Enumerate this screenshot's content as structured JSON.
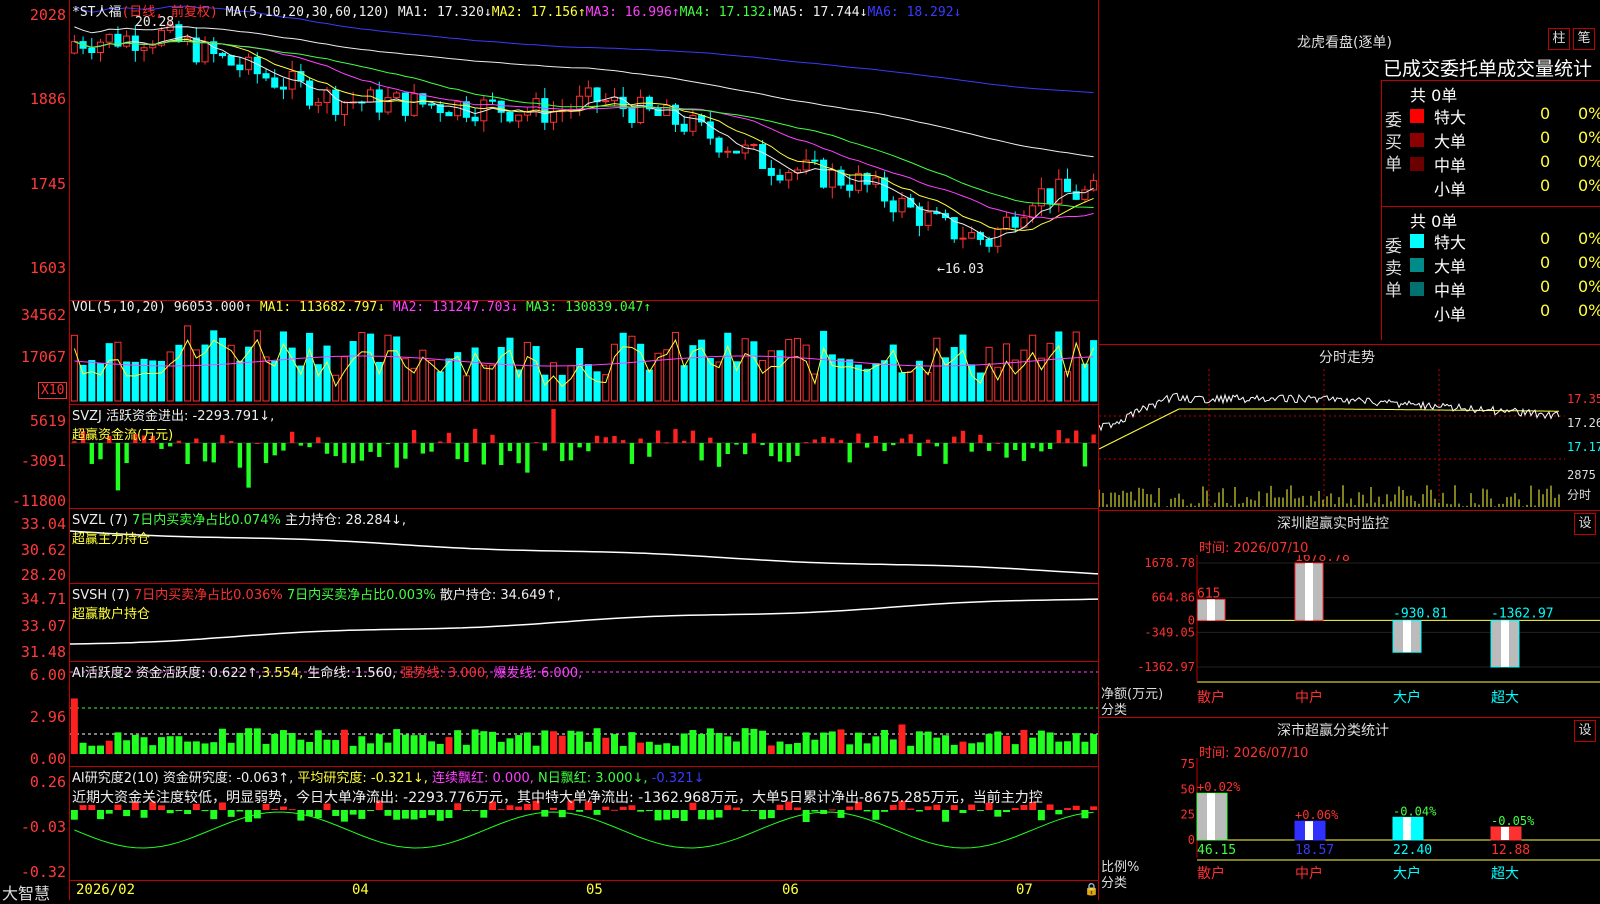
{
  "main_chart": {
    "stock_name": "*ST人福",
    "period_label": "(日线, 前复权)",
    "ma_header": "MA(5,10,20,30,60,120)",
    "ma": [
      {
        "label": "MA1: 17.320↓",
        "color": "#eeeeee"
      },
      {
        "label": "MA2: 17.156↑",
        "color": "#ffff3a"
      },
      {
        "label": "MA3: 16.996↑",
        "color": "#ff40ff"
      },
      {
        "label": "MA4: 17.132↓",
        "color": "#40ff40"
      },
      {
        "label": "MA5: 17.744↓",
        "color": "#eeeeee"
      },
      {
        "label": "MA6: 18.292↓",
        "color": "#3a3aff"
      }
    ],
    "y_ticks": [
      "2028",
      "1886",
      "1745",
      "1603"
    ],
    "high_marker": "20.28",
    "low_marker": "←16.03"
  },
  "vol_panel": {
    "header": "VOL(5,10,20)",
    "value": "96053.000↑",
    "ma1": "MA1: 113682.797↓",
    "ma2": "MA2: 131247.703↓",
    "ma3": "MA3: 130839.047↑",
    "y_ticks": [
      "34562",
      "17067"
    ],
    "unit": "X10"
  },
  "svzj_panel": {
    "header": "SVZJ",
    "line1": "活跃资金进出: -2293.791↓,",
    "line2": "超赢资金流(万元)",
    "y_ticks": [
      "5619",
      "-3091",
      "-11800"
    ]
  },
  "svzl_panel": {
    "header": "SVZL (7)",
    "line1": "7日内买卖净占比0.074%",
    "line1b": "主力持仓: 28.284↓,",
    "line2": "超赢主力持仓",
    "y_ticks": [
      "33.04",
      "30.62",
      "28.20"
    ]
  },
  "svsh_panel": {
    "header": "SVSH (7)",
    "line1": "7日内买卖净占比0.036%",
    "line1b": "7日内买卖净占比0.003%",
    "line1c": "散户持仓: 34.649↑,",
    "line2": "超赢散户持仓",
    "y_ticks": [
      "34.71",
      "33.07",
      "31.48"
    ]
  },
  "ai_active_panel": {
    "header": "AI活跃度2",
    "a": "资金活跃度: 0.622↑,",
    "b": "3.554,",
    "c": "生命线: 1.560,",
    "d": "强势线: 3.000,",
    "e": "爆发线: 6.000,",
    "y_ticks": [
      "6.00",
      "2.96",
      "0.00"
    ]
  },
  "ai_research_panel": {
    "header": "AI研究度2(10)",
    "a": "资金研究度: -0.063↑,",
    "b": "平均研究度: -0.321↓,",
    "c": "连续飘红: 0.000,",
    "d": "N日飘红: 3.000↓,",
    "e": "-0.321↓",
    "commentary": "近期大资金关注度较低，明显弱势，今日大单净流出: -2293.776万元，其中特大单净流出: -1362.968万元，大单5日累计净出-8675.285万元，当前主力控",
    "y_ticks": [
      "0.26",
      "-0.03",
      "-0.32"
    ]
  },
  "x_axis": {
    "labels": [
      "2026/02",
      "04",
      "05",
      "06",
      "07"
    ]
  },
  "bottom_left": {
    "brand": "大智慧"
  },
  "order_book": {
    "title": "龙虎看盘(逐单)",
    "btn_bar": "柱",
    "btn_pen": "笔",
    "tabs": "已成交委托单成交量统计",
    "buy_label": "委买单",
    "sell_label": "委卖单",
    "buy_total": "共 0单",
    "sell_total": "共 0单",
    "buy_rows": [
      {
        "name": "特大",
        "count": "0",
        "pct": "0%",
        "color": "#ff0000"
      },
      {
        "name": "大单",
        "count": "0",
        "pct": "0%",
        "color": "#8b0000"
      },
      {
        "name": "中单",
        "count": "0",
        "pct": "0%",
        "color": "#6b0000"
      },
      {
        "name": "小单",
        "count": "0",
        "pct": "0%",
        "color": "#000000"
      }
    ],
    "sell_rows": [
      {
        "name": "特大",
        "count": "0",
        "pct": "0%",
        "color": "#00ffff"
      },
      {
        "name": "大单",
        "count": "0",
        "pct": "0%",
        "color": "#008b8b"
      },
      {
        "name": "中单",
        "count": "0",
        "pct": "0%",
        "color": "#007070"
      },
      {
        "name": "小单",
        "count": "0",
        "pct": "0%",
        "color": "#000000"
      }
    ]
  },
  "intraday": {
    "title": "分时走势",
    "price_ticks": [
      "17.35",
      "17.26",
      "17.17"
    ],
    "vol_tick": "2875",
    "vol_unit": "分时"
  },
  "sz_monitor": {
    "title": "深圳超赢实时监控",
    "settings": "设",
    "time": "时间: 2026/07/10",
    "y_ticks": [
      "1678.78",
      "664.86",
      "0",
      "-349.05",
      "-1362.97"
    ],
    "axis_title": "净额(万元)",
    "axis_sub": "分类",
    "chart_data": {
      "type": "bar",
      "categories": [
        "散户",
        "中户",
        "大户",
        "超大"
      ],
      "values": [
        615,
        1678.78,
        -930.81,
        -1362.97
      ],
      "value_labels": [
        "615",
        "1678.78",
        "-930.81",
        "-1362.97"
      ]
    }
  },
  "sz_category": {
    "title": "深市超赢分类统计",
    "settings": "设",
    "time": "时间: 2026/07/10",
    "y_ticks": [
      "75",
      "50",
      "25",
      "0"
    ],
    "axis_title": "比例%",
    "axis_sub": "分类",
    "chart_data": {
      "type": "bar",
      "categories": [
        "散户",
        "中户",
        "大户",
        "超大"
      ],
      "values": [
        46.15,
        18.57,
        22.4,
        12.88
      ],
      "changes": [
        "+0.02%",
        "+0.06%",
        "-0.04%",
        "-0.05%"
      ],
      "value_labels": [
        "46.15",
        "18.57",
        "22.40",
        "12.88"
      ],
      "ylim": [
        0,
        75
      ]
    }
  }
}
